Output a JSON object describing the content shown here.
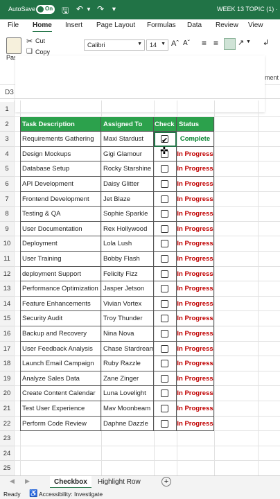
{
  "titlebar": {
    "autosave_label": "AutoSave",
    "autosave_state": "On",
    "file_title": "WEEK 13 TOPIC (1) ·"
  },
  "menu": {
    "items": [
      "File",
      "Home",
      "Insert",
      "Page Layout",
      "Formulas",
      "Data",
      "Review",
      "View"
    ],
    "active": "Home"
  },
  "ribbon": {
    "cut_label": "Cut",
    "copy_label": "Copy",
    "paste_label": "Pas",
    "font_name": "Calibri",
    "font_size": "14",
    "right_fragment": "ment"
  },
  "namebox": "D3",
  "rows": [
    "1",
    "2",
    "3",
    "4",
    "5",
    "6",
    "7",
    "8",
    "9",
    "10",
    "11",
    "12",
    "13",
    "14",
    "15",
    "16",
    "17",
    "18",
    "19",
    "20",
    "21",
    "22",
    "23",
    "24",
    "25"
  ],
  "table": {
    "headers": [
      "Task Description",
      "Assigned To",
      "Check",
      "Status"
    ],
    "tasks": [
      {
        "task": "Requirements Gathering",
        "assigned": "Maxi Stardust",
        "checked": true,
        "status": "Complete"
      },
      {
        "task": "Design Mockups",
        "assigned": "Gigi Glamour",
        "checked": false,
        "status": "In Progress"
      },
      {
        "task": "Database Setup",
        "assigned": "Rocky Starshine",
        "checked": false,
        "status": "In Progress"
      },
      {
        "task": "API Development",
        "assigned": "Daisy Glitter",
        "checked": false,
        "status": "In Progress"
      },
      {
        "task": "Frontend Development",
        "assigned": "Jet Blaze",
        "checked": false,
        "status": "In Progress"
      },
      {
        "task": "Testing & QA",
        "assigned": "Sophie Sparkle",
        "checked": false,
        "status": "In Progress"
      },
      {
        "task": "User Documentation",
        "assigned": "Rex Hollywood",
        "checked": false,
        "status": "In Progress"
      },
      {
        "task": "Deployment",
        "assigned": "Lola Lush",
        "checked": false,
        "status": "In Progress"
      },
      {
        "task": "User Training",
        "assigned": "Bobby Flash",
        "checked": false,
        "status": "In Progress"
      },
      {
        "task": "deployment Support",
        "assigned": "Felicity Fizz",
        "checked": false,
        "status": "In Progress"
      },
      {
        "task": "Performance Optimization",
        "assigned": "Jasper Jetson",
        "checked": false,
        "status": "In Progress"
      },
      {
        "task": "Feature Enhancements",
        "assigned": "Vivian Vortex",
        "checked": false,
        "status": "In Progress"
      },
      {
        "task": "Security Audit",
        "assigned": "Troy Thunder",
        "checked": false,
        "status": "In Progress"
      },
      {
        "task": "Backup and Recovery",
        "assigned": "Nina Nova",
        "checked": false,
        "status": "In Progress"
      },
      {
        "task": "User Feedback Analysis",
        "assigned": "Chase Stardream",
        "checked": false,
        "status": "In Progress"
      },
      {
        "task": "Launch Email Campaign",
        "assigned": "Ruby Razzle",
        "checked": false,
        "status": "In Progress"
      },
      {
        "task": "Analyze Sales Data",
        "assigned": "Zane Zinger",
        "checked": false,
        "status": "In Progress"
      },
      {
        "task": "Create Content Calendar",
        "assigned": "Luna Lovelight",
        "checked": false,
        "status": "In Progress"
      },
      {
        "task": "Test User Experience",
        "assigned": "Mav Moonbeam",
        "checked": false,
        "status": "In Progress"
      },
      {
        "task": "Perform Code Review",
        "assigned": "Daphne Dazzle",
        "checked": false,
        "status": "In Progress"
      }
    ]
  },
  "sheet_tabs": [
    "Checkbox",
    "Highlight Row"
  ],
  "active_sheet": "Checkbox",
  "statusbar": {
    "ready": "Ready",
    "accessibility": "Accessibility: Investigate"
  },
  "colors": {
    "excel_green": "#217346",
    "header_green": "#2ca14c",
    "in_progress": "#c00000",
    "complete": "#00802b"
  }
}
